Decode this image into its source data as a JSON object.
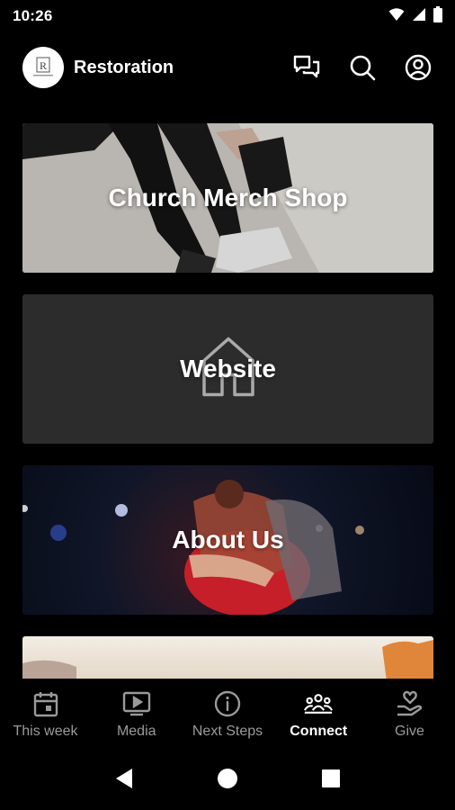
{
  "status": {
    "time": "10:26"
  },
  "header": {
    "title": "Restoration",
    "logo_text": "R"
  },
  "cards": [
    {
      "label": "Church Merch Shop"
    },
    {
      "label": "Website"
    },
    {
      "label": "About Us"
    }
  ],
  "tabs": [
    {
      "label": "This week",
      "icon": "calendar-icon",
      "active": false
    },
    {
      "label": "Media",
      "icon": "play-icon",
      "active": false
    },
    {
      "label": "Next Steps",
      "icon": "info-icon",
      "active": false
    },
    {
      "label": "Connect",
      "icon": "people-icon",
      "active": true
    },
    {
      "label": "Give",
      "icon": "heart-hand-icon",
      "active": false
    }
  ],
  "colors": {
    "background": "#000000",
    "card_dark": "#2c2c2c",
    "inactive_tab": "#9a9a9a",
    "active_tab": "#ffffff"
  }
}
